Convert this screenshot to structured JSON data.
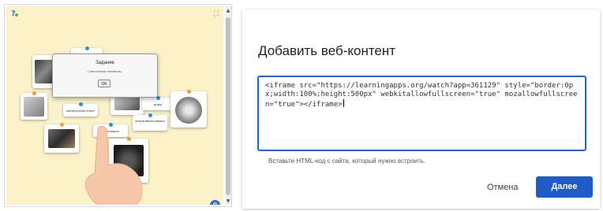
{
  "app_preview": {
    "task_dialog": {
      "title": "Задание",
      "text": "Сопоставьте элементы.",
      "ok_label": "OK"
    },
    "cards": [
      {
        "label": "жесткий диск"
      },
      {
        "label": "материнская плата"
      },
      {
        "label": "кулер"
      },
      {
        "label": "оперативная память"
      },
      {
        "label": "видеокарта"
      }
    ],
    "icons": {
      "help": "help-icon",
      "fullscreen": "fullscreen-icon",
      "corner": "app-corner-icon"
    },
    "colors": {
      "canvas": "#fbf2c9",
      "pin_blue": "#2a8fd6",
      "pin_orange": "#f2993b"
    }
  },
  "embed_dialog": {
    "title": "Добавить веб-контент",
    "code": "<iframe src=\"https://learningapps.org/watch?app=361129\" style=\"border:0px;width:100%;height:500px\" webkitallowfullscreen=\"true\" mozallowfullscreen=\"true\"></iframe>",
    "hint": "Вставьте HTML-код с сайта, который нужно встроить.",
    "cancel_label": "Отмена",
    "next_label": "Далее",
    "colors": {
      "accent": "#1e5bc6",
      "border": "#1a66d2"
    }
  }
}
